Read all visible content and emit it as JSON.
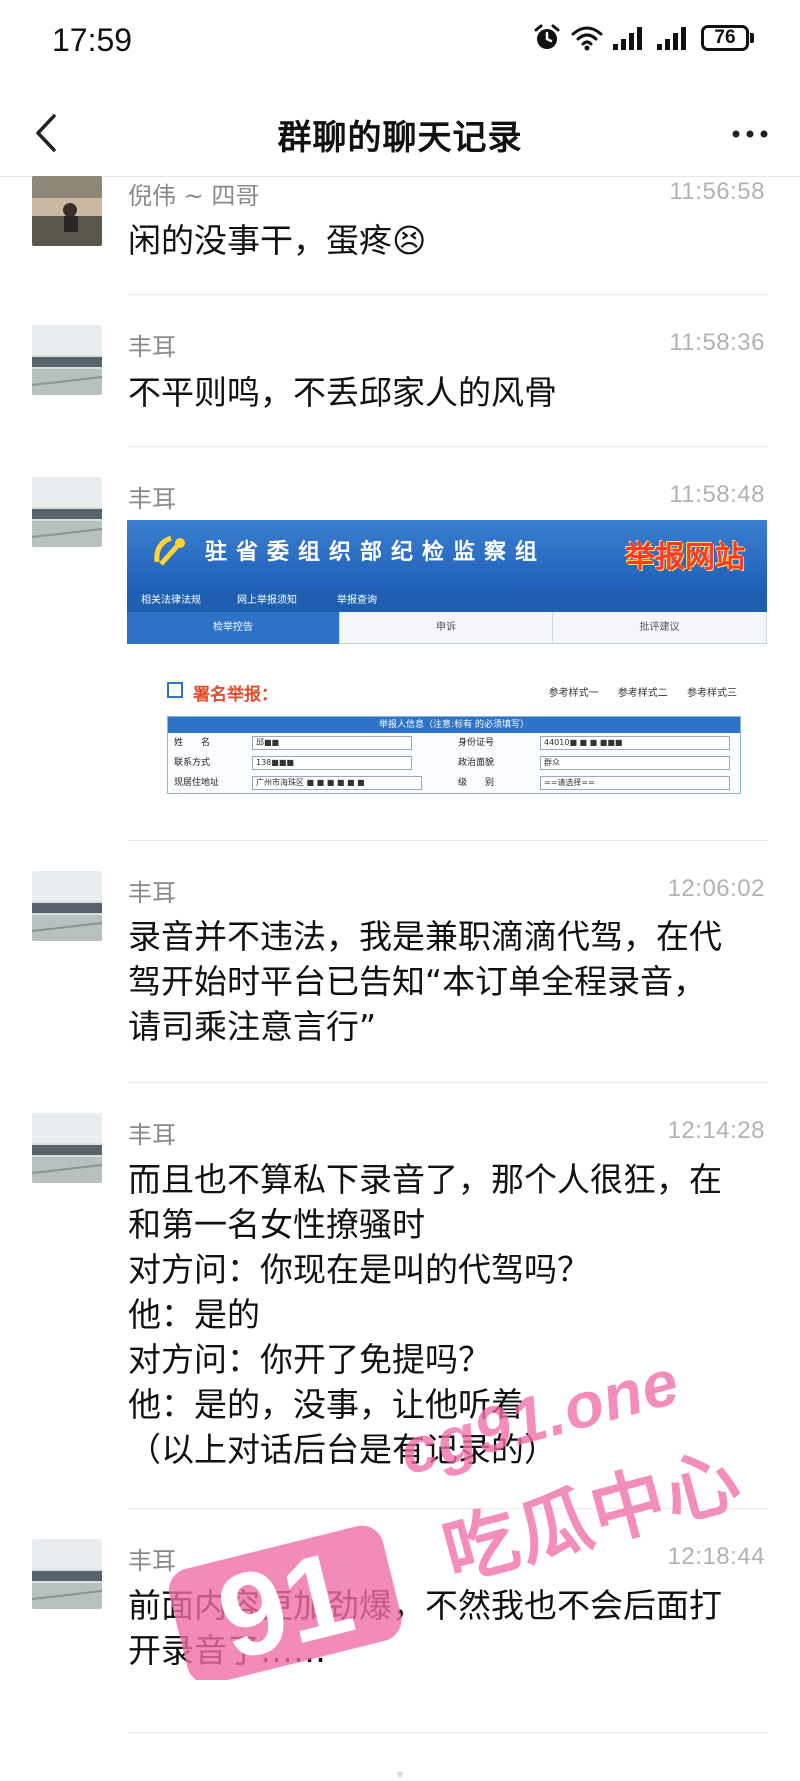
{
  "status_bar": {
    "time": "17:59",
    "icons": [
      "alarm-icon",
      "wifi-icon",
      "signal-icon",
      "signal-icon"
    ],
    "battery": "76"
  },
  "header": {
    "title": "群聊的聊天记录",
    "back_icon": "chevron-left-icon",
    "more_icon": "more-horizontal-icon"
  },
  "messages": [
    {
      "sender": "倪伟 ~ 四哥",
      "time": "11:56:58",
      "text": "闲的没事干，蛋疼😣"
    },
    {
      "sender": "丰耳",
      "time": "11:58:36",
      "text": "不平则鸣，不丢邱家人的风骨"
    },
    {
      "sender": "丰耳",
      "time": "11:58:48",
      "image": {
        "banner_title": "驻省委组织部纪检监察组",
        "banner_badge": "举报网站",
        "links": [
          "相关法律法规",
          "网上举报须知",
          "举报查询"
        ],
        "tabs": [
          "检举控告",
          "申诉",
          "批评建议"
        ],
        "form_title": "署名举报：",
        "samples": [
          "参考样式一",
          "参考样式二",
          "参考样式三"
        ],
        "table_header": "举报人信息（注意:标有  的必须填写）",
        "rows": [
          {
            "label_left": "姓　　名",
            "value_left": "邱■■",
            "label_right": "身份证号",
            "value_right": "44010■ ■ ■ ■■■"
          },
          {
            "label_left": "联系方式",
            "value_left": "138■■■",
            "label_right": "政治面貌",
            "value_right": "群众"
          },
          {
            "label_left": "现居住地址",
            "value_left": "广州市海珠区 ■ ■ ■ ■ ■ ■",
            "label_right": "级　　别",
            "value_right": "==请选择=="
          }
        ]
      }
    },
    {
      "sender": "丰耳",
      "time": "12:06:02",
      "text": "录音并不违法，我是兼职滴滴代驾，在代\n驾开始时平台已告知“本订单全程录音，\n请司乘注意言行”"
    },
    {
      "sender": "丰耳",
      "time": "12:14:28",
      "text": "而且也不算私下录音了，那个人很狂，在\n和第一名女性撩骚时\n对方问：你现在是叫的代驾吗？\n他：是的\n对方问：你开了免提吗？\n他：是的，没事，让他听着\n（以上对话后台是有记录的）"
    },
    {
      "sender": "丰耳",
      "time": "12:18:44",
      "text": "前面内容更加劲爆，不然我也不会后面打\n开录音了……"
    }
  ],
  "watermark": {
    "logo": "91",
    "domain": "cg91.one",
    "slogan": "吃瓜中心"
  }
}
